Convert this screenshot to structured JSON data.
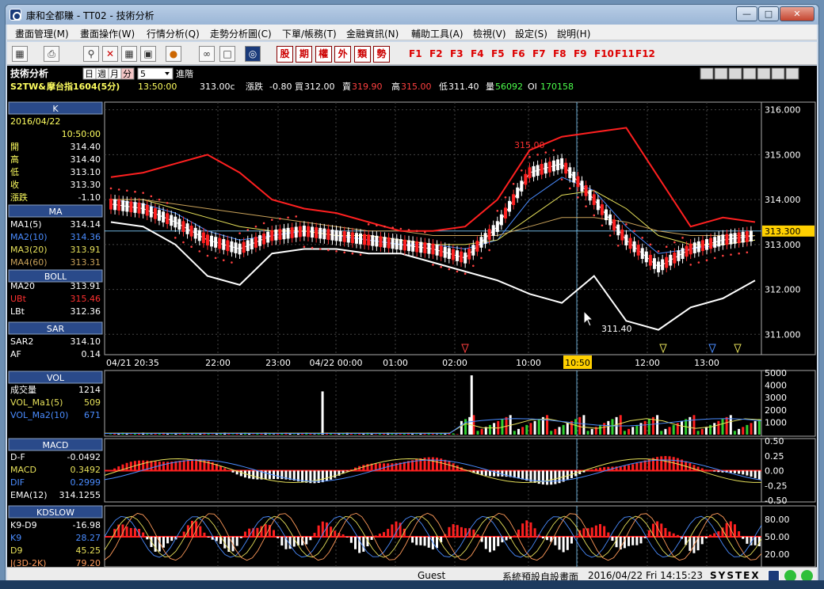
{
  "window": {
    "title": "康和全都賺 - TT02 - 技術分析"
  },
  "menu": [
    "畫面管理(M)",
    "畫面操作(W)",
    "行情分析(Q)",
    "走勢分析圖(C)",
    "下單/帳務(T)",
    "金融資訊(N)",
    "輔助工具(A)",
    "檢視(V)",
    "設定(S)",
    "說明(H)"
  ],
  "toolbar": {
    "red_buttons": [
      "股",
      "期",
      "權",
      "外",
      "類",
      "勢"
    ],
    "fkeys": [
      "F1",
      "F2",
      "F3",
      "F4",
      "F5",
      "F6",
      "F7",
      "F8",
      "F9",
      "F10",
      "F11",
      "F12"
    ]
  },
  "header": {
    "panel_title": "技術分析",
    "period_tabs": [
      "日",
      "週",
      "月",
      "分"
    ],
    "period_value": "5",
    "advanced": "進階",
    "symbol": "S2TW&",
    "name": "摩台指1604(5分)",
    "time": "13:50:00",
    "quote": {
      "last": "313.00c",
      "change_label": "漲跌",
      "change": "-0.80",
      "bid_label": "買",
      "bid": "312.00",
      "ask_label": "賣",
      "ask": "319.90",
      "high_label": "高",
      "high": "315.00",
      "low_label": "低",
      "low": "311.40",
      "vol_label": "量",
      "vol": "56092",
      "oi_label": "OI",
      "oi": "170158"
    }
  },
  "left_panel": {
    "k": {
      "title": "K",
      "date": "2016/04/22",
      "time": "10:50:00",
      "rows": [
        {
          "label": "開",
          "value": "314.40"
        },
        {
          "label": "高",
          "value": "314.40"
        },
        {
          "label": "低",
          "value": "313.10"
        },
        {
          "label": "收",
          "value": "313.30"
        },
        {
          "label": "漲跌",
          "value": "-1.10"
        }
      ]
    },
    "ma": {
      "title": "MA",
      "rows": [
        {
          "label": "MA1(5)",
          "value": "314.14",
          "color": "#ffffff"
        },
        {
          "label": "MA2(10)",
          "value": "314.36",
          "color": "#4a8cff"
        },
        {
          "label": "MA3(20)",
          "value": "313.91",
          "color": "#e6e05a"
        },
        {
          "label": "MA4(60)",
          "value": "313.31",
          "color": "#c9a25a"
        }
      ]
    },
    "boll": {
      "title": "BOLL",
      "rows": [
        {
          "label": "MA20",
          "value": "313.91",
          "color": "#ffffff"
        },
        {
          "label": "UBt",
          "value": "315.46",
          "color": "#ff3030"
        },
        {
          "label": "LBt",
          "value": "312.36",
          "color": "#ffffff"
        }
      ]
    },
    "sar": {
      "title": "SAR",
      "rows": [
        {
          "label": "SAR2",
          "value": "314.10",
          "color": "#ffffff"
        },
        {
          "label": "AF",
          "value": "0.14",
          "color": "#ffffff"
        }
      ]
    },
    "vol": {
      "title": "VOL",
      "rows": [
        {
          "label": "成交量",
          "value": "1214",
          "color": "#ffffff"
        },
        {
          "label": "VOL_Ma1(5)",
          "value": "509",
          "color": "#e6e05a"
        },
        {
          "label": "VOL_Ma2(10)",
          "value": "671",
          "color": "#4a8cff"
        }
      ]
    },
    "macd": {
      "title": "MACD",
      "rows": [
        {
          "label": "D-F",
          "value": "-0.0492",
          "color": "#ffffff"
        },
        {
          "label": "MACD",
          "value": "0.3492",
          "color": "#e6e05a"
        },
        {
          "label": "DIF",
          "value": "0.2999",
          "color": "#4a8cff"
        },
        {
          "label": "EMA(12)",
          "value": "314.1255",
          "color": "#ffffff"
        }
      ]
    },
    "kd": {
      "title": "KDSLOW",
      "rows": [
        {
          "label": "K9-D9",
          "value": "-16.98",
          "color": "#ffffff"
        },
        {
          "label": "K9",
          "value": "28.27",
          "color": "#4a8cff"
        },
        {
          "label": "D9",
          "value": "45.25",
          "color": "#e6e05a"
        },
        {
          "label": "J(3D-2K)",
          "value": "79.20",
          "color": "#ff9a5a"
        }
      ]
    }
  },
  "chart_data": [
    {
      "type": "line",
      "title": "",
      "y_ticks": [
        "316.000",
        "315.000",
        "314.000",
        "313.000",
        "312.000",
        "311.000"
      ],
      "ylim": [
        310.6,
        316.1
      ],
      "x_ticks": [
        "04/21 20:35",
        "22:00",
        "23:00",
        "04/22 00:00",
        "01:00",
        "02:00",
        "10:00",
        "10:50",
        "12:00",
        "13:00"
      ],
      "current_price": "313.300",
      "annotations": [
        "315.00",
        "311.40"
      ],
      "series": [
        {
          "name": "MA1(5)",
          "values": [
            313.9,
            313.8,
            313.5,
            313.1,
            312.9,
            313.2,
            313.3,
            313.2,
            313.1,
            313.0,
            312.9,
            312.7,
            313.4,
            314.6,
            314.8,
            314.0,
            313.1,
            312.5,
            312.9,
            313.1,
            313.2
          ]
        },
        {
          "name": "MA2(10)",
          "values": [
            314.0,
            313.9,
            313.7,
            313.3,
            313.1,
            313.2,
            313.3,
            313.2,
            313.1,
            313.0,
            313.0,
            312.9,
            313.1,
            314.0,
            314.5,
            314.2,
            313.4,
            312.8,
            312.9,
            313.0,
            313.1
          ]
        },
        {
          "name": "MA3(20)",
          "values": [
            314.0,
            314.0,
            313.8,
            313.6,
            313.4,
            313.3,
            313.3,
            313.2,
            313.2,
            313.1,
            313.0,
            313.0,
            313.1,
            313.6,
            314.1,
            314.2,
            313.8,
            313.2,
            313.0,
            313.0,
            313.1
          ]
        },
        {
          "name": "MA4(60)",
          "values": [
            314.0,
            314.0,
            313.9,
            313.8,
            313.7,
            313.6,
            313.5,
            313.4,
            313.3,
            313.3,
            313.2,
            313.2,
            313.2,
            313.4,
            313.6,
            313.6,
            313.5,
            313.3,
            313.2,
            313.2,
            313.2
          ]
        },
        {
          "name": "UBt",
          "values": [
            314.5,
            314.6,
            314.8,
            315.0,
            314.6,
            314.0,
            313.8,
            313.7,
            313.5,
            313.3,
            313.3,
            313.4,
            314.0,
            315.1,
            315.4,
            315.5,
            315.6,
            314.5,
            313.4,
            313.6,
            313.5
          ]
        },
        {
          "name": "LBt",
          "values": [
            313.5,
            313.4,
            313.0,
            312.3,
            312.1,
            312.8,
            312.9,
            312.9,
            312.8,
            312.8,
            312.6,
            312.4,
            312.2,
            311.9,
            311.7,
            312.3,
            311.3,
            311.1,
            311.6,
            311.8,
            312.2
          ]
        }
      ]
    },
    {
      "type": "bar",
      "title": "",
      "y_ticks": [
        "5000",
        "4000",
        "3000",
        "2000",
        "1000"
      ],
      "ylim": [
        0,
        5000
      ],
      "spikes": [
        {
          "x": 0.33,
          "value": 3500
        },
        {
          "x": 0.557,
          "value": 4800
        }
      ]
    },
    {
      "type": "bar",
      "title": "",
      "y_ticks": [
        "0.50",
        "0.25",
        "0.00",
        "-0.25",
        "-0.50"
      ],
      "ylim": [
        -0.5,
        0.5
      ]
    },
    {
      "type": "line",
      "title": "",
      "y_ticks": [
        "80.00",
        "50.00",
        "20.00"
      ],
      "ylim": [
        0,
        100
      ]
    }
  ],
  "status": {
    "user": "Guest",
    "screen": "系統預設自設畫面",
    "datetime": "2016/04/22 Fri 14:15:23",
    "brand": "SYSTEX"
  }
}
